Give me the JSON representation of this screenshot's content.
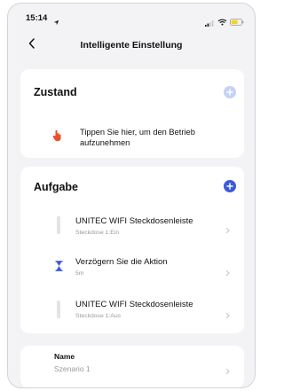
{
  "status_bar": {
    "time": "15:14"
  },
  "header": {
    "title": "Intelligente Einstellung",
    "back_icon": "chevron-left-icon"
  },
  "colors": {
    "accent": "#3b5bdb",
    "accent_light": "#c5d2f4",
    "condition_icon": "#e8532d",
    "delay_icon": "#3b5bdb",
    "background": "#f3f3f6"
  },
  "condition": {
    "title": "Zustand",
    "item_text": "Tippen Sie hier, um den Betrieb aufzunehmen"
  },
  "task": {
    "title": "Aufgabe",
    "items": [
      {
        "title": "UNITEC WIFI Steckdosenleiste",
        "subtitle": "Steckdose 1:Ein",
        "icon": "power-strip-icon"
      },
      {
        "title": "Verzögern Sie die Aktion",
        "subtitle": "5m",
        "icon": "hourglass-icon"
      },
      {
        "title": "UNITEC WIFI Steckdosenleiste",
        "subtitle": "Steckdose 1:Aus",
        "icon": "power-strip-icon"
      }
    ]
  },
  "name": {
    "label": "Name",
    "value": "Szenario 1"
  }
}
